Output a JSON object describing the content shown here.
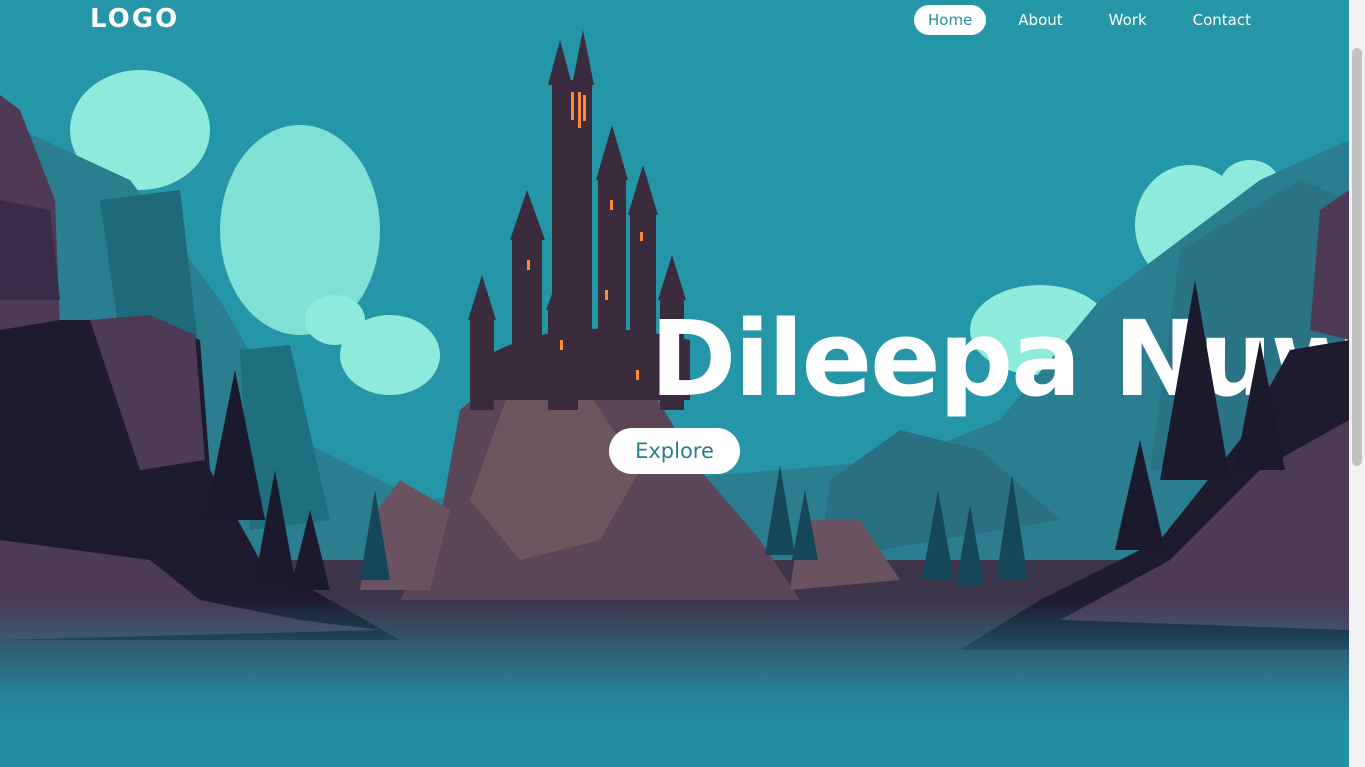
{
  "header": {
    "logo": "LOGO",
    "nav": [
      {
        "label": "Home",
        "active": true
      },
      {
        "label": "About",
        "active": false
      },
      {
        "label": "Work",
        "active": false
      },
      {
        "label": "Contact",
        "active": false
      }
    ]
  },
  "hero": {
    "title": "Dileepa Nuw",
    "button_label": "Explore",
    "illustration": "castle-mountain-landscape"
  },
  "colors": {
    "sky": "#2596a8",
    "cloud": "#8eeadb",
    "rock": "#4e3a52",
    "dark_rock": "#1e1c30",
    "tree": "#1b1a2c",
    "accent_text": "#2a8da0"
  }
}
